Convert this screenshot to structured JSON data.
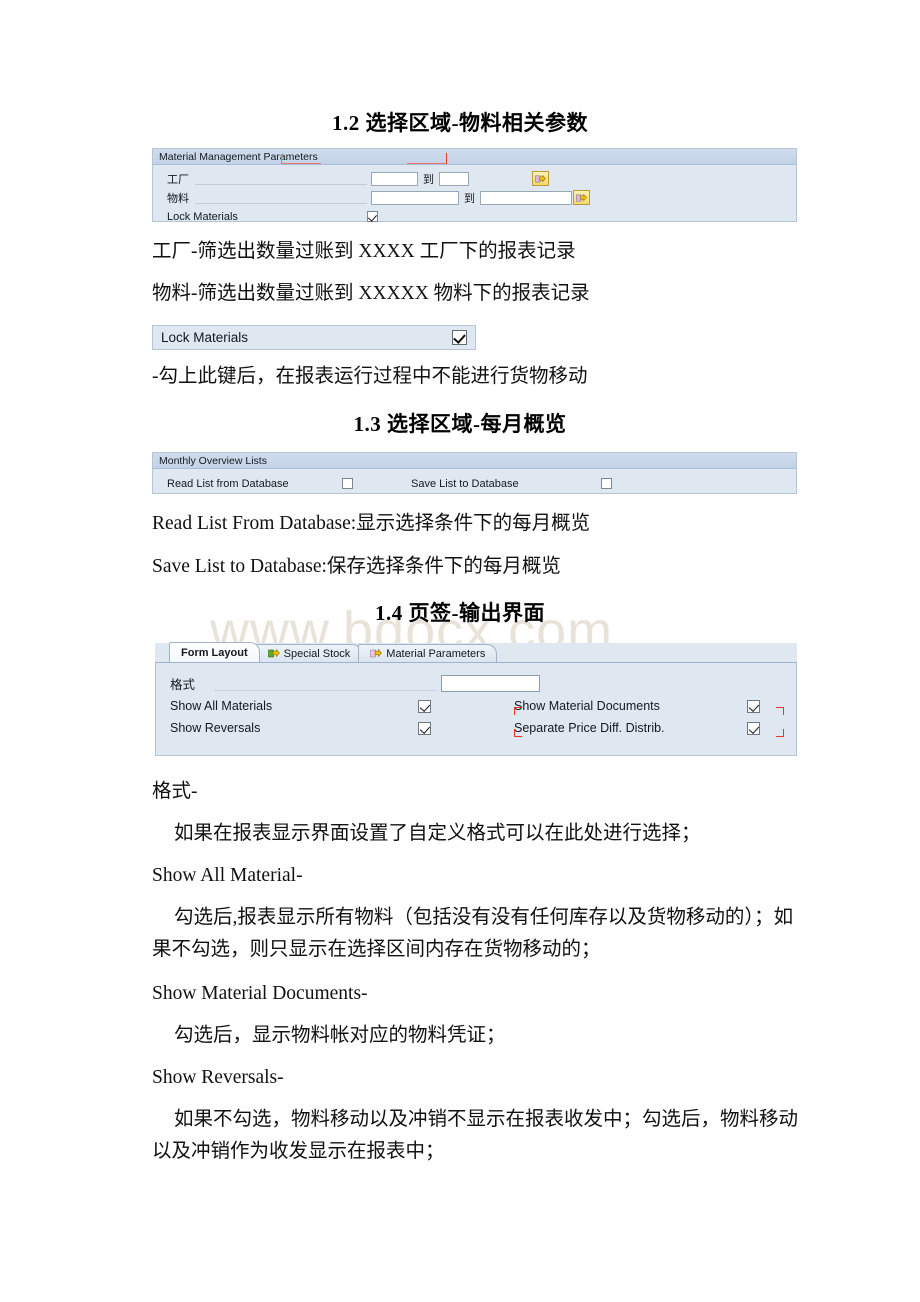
{
  "document": {
    "watermark": "www.bdocx.com"
  },
  "sections": {
    "heading_1_2": "1.2 选择区域-物料相关参数",
    "heading_1_3": "1.3 选择区域-每月概览",
    "heading_1_4": "1.4 页签-输出界面"
  },
  "material_panel": {
    "title": "Material Management Parameters",
    "rows": [
      {
        "label": "工厂",
        "to_label": "到",
        "from_value": "",
        "to_value": "",
        "multi_icon": "multi-select-arrow-icon"
      },
      {
        "label": "物料",
        "to_label": "到",
        "from_value": "",
        "to_value": "",
        "multi_icon": "multi-select-arrow-icon"
      }
    ],
    "lock_row": {
      "label": "Lock Materials",
      "checked": true
    }
  },
  "paragraphs": {
    "plant_desc": "工厂-筛选出数量过账到 XXXX 工厂下的报表记录",
    "material_desc": "物料-筛选出数量过账到 XXXXX 物料下的报表记录",
    "lock_desc": "-勾上此键后，在报表运行过程中不能进行货物移动",
    "read_list_desc": "Read List From Database:显示选择条件下的每月概览",
    "save_list_desc": "Save List to Database:保存选择条件下的每月概览",
    "format_title": "格式-",
    "format_desc": "如果在报表显示界面设置了自定义格式可以在此处进行选择；",
    "show_all_material_title": "Show All Material-",
    "show_all_material_desc": "勾选后,报表显示所有物料（包括没有没有任何库存以及货物移动的）；如果不勾选，则只显示在选择区间内存在货物移动的；",
    "show_material_documents_title": "Show Material Documents-",
    "show_material_documents_desc": "勾选后，显示物料帐对应的物料凭证；",
    "show_reversals_title": "Show Reversals-",
    "show_reversals_desc": "如果不勾选，物料移动以及冲销不显示在报表收发中；勾选后，物料移动以及冲销作为收发显示在报表中；"
  },
  "lock_materials_strip": {
    "label": "Lock Materials",
    "checked": true
  },
  "monthly_panel": {
    "title": "Monthly Overview Lists",
    "options": [
      {
        "label": "Read List from Database",
        "checked": false
      },
      {
        "label": "Save List to Database",
        "checked": false
      }
    ]
  },
  "output_tabs": {
    "tabs": [
      {
        "label": "Form Layout",
        "active": true,
        "icon": null
      },
      {
        "label": "Special Stock",
        "active": false,
        "icon": "green-arrow-icon"
      },
      {
        "label": "Material Parameters",
        "active": false,
        "icon": "pink-arrow-icon"
      }
    ],
    "format_field": {
      "label": "格式",
      "value": ""
    },
    "checkboxes_left": [
      {
        "label": "Show All Materials",
        "checked": true
      },
      {
        "label": "Show Reversals",
        "checked": true
      }
    ],
    "checkboxes_right": [
      {
        "label": "Show Material Documents",
        "checked": true
      },
      {
        "label": "Separate Price Diff. Distrib.",
        "checked": true,
        "annotated": true
      }
    ]
  },
  "colors": {
    "panel_bg": "#dfe7f1",
    "panel_border": "#b6c4d6",
    "titlebar": "#c7d6e8",
    "annotation_red": "#e8362b",
    "button_yellow": "#f4dc78",
    "watermark": "#e8e3d8"
  }
}
